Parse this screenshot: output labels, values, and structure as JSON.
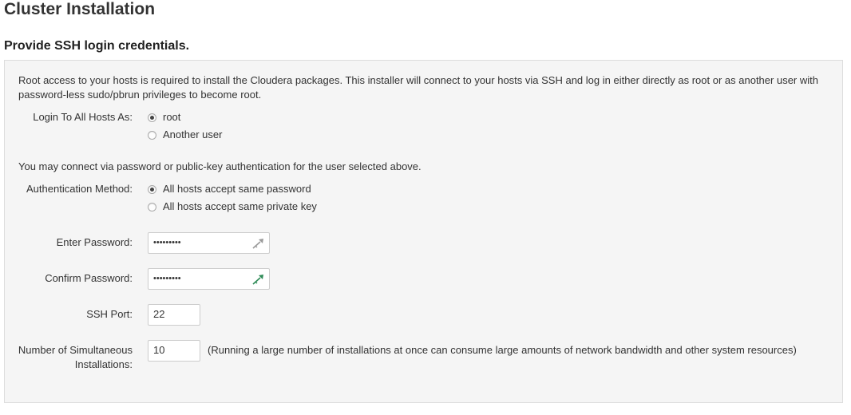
{
  "header": {
    "title": "Cluster Installation"
  },
  "section": {
    "title": "Provide SSH login credentials."
  },
  "intro": {
    "text": "Root access to your hosts is required to install the Cloudera packages. This installer will connect to your hosts via SSH and log in either directly as root or as another user with password-less sudo/pbrun privileges to become root."
  },
  "login": {
    "label": "Login To All Hosts As:",
    "options": [
      {
        "label": "root",
        "checked": true
      },
      {
        "label": "Another user",
        "checked": false
      }
    ]
  },
  "auth_note": "You may connect via password or public-key authentication for the user selected above.",
  "auth": {
    "label": "Authentication Method:",
    "options": [
      {
        "label": "All hosts accept same password",
        "checked": true
      },
      {
        "label": "All hosts accept same private key",
        "checked": false
      }
    ]
  },
  "password": {
    "label": "Enter Password:",
    "value": "•••••••••",
    "icon": "key-icon"
  },
  "confirm": {
    "label": "Confirm Password:",
    "value": "•••••••••",
    "icon": "key-icon"
  },
  "ssh_port": {
    "label": "SSH Port:",
    "value": "22"
  },
  "simultaneous": {
    "label_line1": "Number of Simultaneous",
    "label_line2": "Installations:",
    "value": "10",
    "note": "(Running a large number of installations at once can consume large amounts of network bandwidth and other system resources)"
  },
  "colors": {
    "key_gray": "#9a9a9a",
    "key_green": "#2e8b57"
  }
}
